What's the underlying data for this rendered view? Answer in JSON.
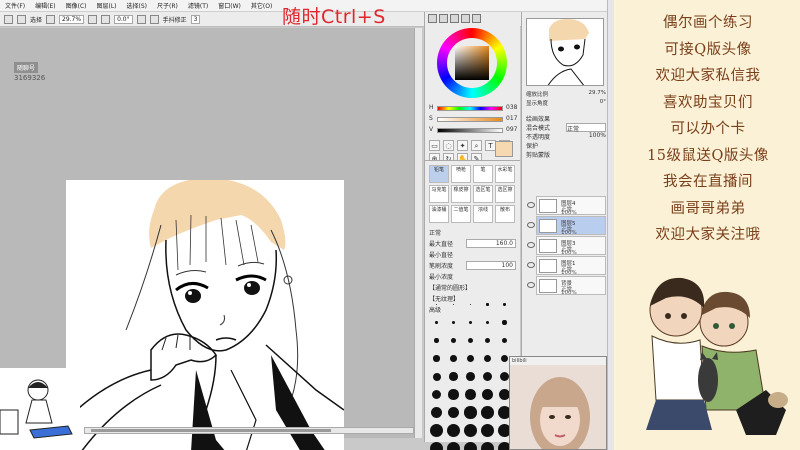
{
  "menu": {
    "items": [
      "文件(F)",
      "编辑(E)",
      "图像(C)",
      "图层(L)",
      "选择(S)",
      "尺子(R)",
      "滤镜(T)",
      "窗口(W)",
      "其它(O)"
    ]
  },
  "toolbar": {
    "select_label": "选择",
    "zoom": "29.7%",
    "rotation": "0.0°",
    "stabilizer_label": "手抖修正",
    "stabilizer_value": "3"
  },
  "overlay_hint": "随时Ctrl+S",
  "navigator": {
    "badge": "随聊号",
    "number": "3169326"
  },
  "color_panel": {
    "sliders": [
      {
        "label": "H",
        "value": "038"
      },
      {
        "label": "S",
        "value": "017"
      },
      {
        "label": "V",
        "value": "097"
      }
    ],
    "tool_text": "T",
    "current_color": "#f6d8b1"
  },
  "brush_panel": {
    "brushes": [
      "铅笔",
      "喷枪",
      "笔",
      "水彩笔",
      "马克笔",
      "橡皮擦",
      "选区笔",
      "选区擦",
      "油漆桶",
      "二值笔",
      "浓线",
      "散布"
    ],
    "mode": "正常",
    "size_label": "最大直径",
    "size_value": "160.0",
    "min_size_label": "最小直径",
    "density_label": "笔刷浓度",
    "density_value": "100",
    "min_density_label": "最小浓度",
    "texture_1": "【通常的圆形】",
    "texture_2": "【无纹理】",
    "advanced": "高级",
    "size_grid": [
      "0.6",
      "0.8",
      "1",
      "1.5",
      "2",
      "2.3",
      "2.6",
      "3",
      "3.5",
      "4",
      "5",
      "6",
      "7",
      "8",
      "9",
      "10",
      "12",
      "14",
      "16",
      "20",
      "25",
      "30",
      "35",
      "40",
      "50",
      "60",
      "70",
      "80",
      "100",
      "120",
      "140",
      "160",
      "200",
      "250",
      "300",
      "350",
      "400",
      "500",
      "600",
      "700",
      "800",
      "1000",
      "1200",
      "1500",
      "2000"
    ]
  },
  "layer_panel": {
    "zoom_label": "缩放比例",
    "zoom_value": "29.7%",
    "angle_label": "显示角度",
    "angle_value": "0°",
    "effect_label": "绘画效果",
    "blend_label": "混合模式",
    "blend_value": "正常",
    "opacity_label": "不透明度",
    "opacity_value": "100%",
    "protect_label": "保护",
    "clip_label": "剪贴蒙版",
    "layers": [
      {
        "name": "图层4",
        "mode": "正常",
        "opacity": "100%"
      },
      {
        "name": "图层5",
        "mode": "正常",
        "opacity": "100%"
      },
      {
        "name": "图层3",
        "mode": "正常",
        "opacity": "100%"
      },
      {
        "name": "图层1",
        "mode": "正常",
        "opacity": "100%"
      },
      {
        "name": "背景",
        "mode": "正常",
        "opacity": "100%"
      }
    ]
  },
  "webcam_title": "bilibili",
  "stream_text": [
    "偶尔画个练习",
    "可接Q版头像",
    "欢迎大家私信我",
    "喜欢助宝贝们",
    "可以办个卡",
    "15级鼠送Q版头像",
    "我会在直播间",
    "画哥哥弟弟",
    "欢迎大家关注哦"
  ],
  "colors": {
    "accent_red": "#e0262b",
    "stream_text": "#7a3f1a",
    "hair": "#f5d7ae"
  }
}
